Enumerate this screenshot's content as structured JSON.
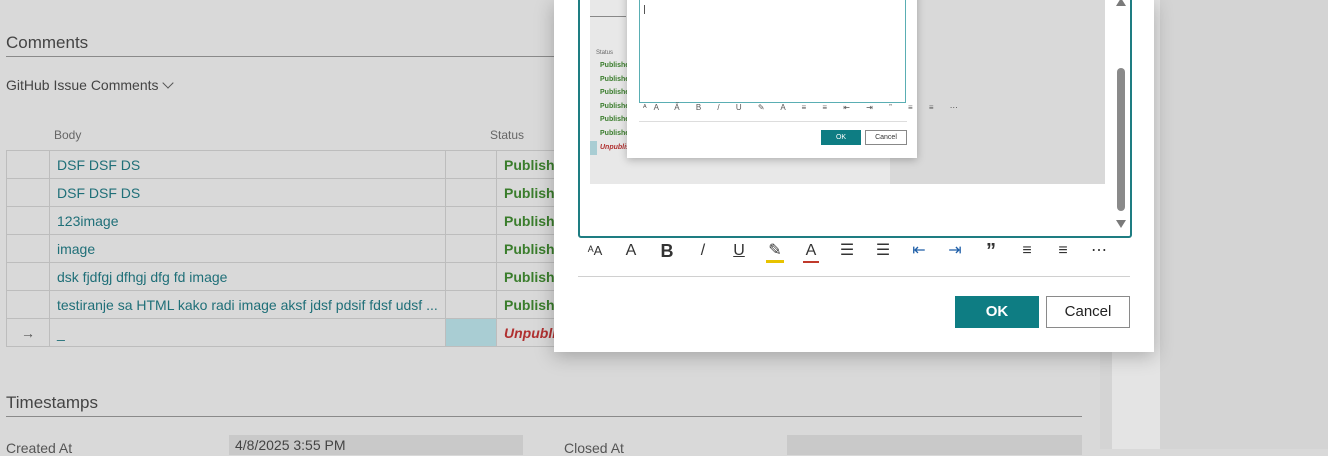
{
  "comments": {
    "section_title": "Comments",
    "sub_link": "GitHub Issue Comments",
    "columns": {
      "body": "Body",
      "status": "Status"
    },
    "rows": [
      {
        "marker": "",
        "body": "DSF DSF DS",
        "status": "Published"
      },
      {
        "marker": "",
        "body": "DSF DSF DS",
        "status": "Published"
      },
      {
        "marker": "",
        "body": "123image",
        "status": "Published"
      },
      {
        "marker": "",
        "body": "image",
        "status": "Published"
      },
      {
        "marker": "",
        "body": "dsk fjdfgj dfhgj dfg fd image",
        "status": "Published"
      },
      {
        "marker": "",
        "body": "testiranje sa HTML kako radi image aksf jdsf pdsif fdsf udsf ...",
        "status": "Published"
      },
      {
        "marker": "→",
        "body": "_",
        "status": "Unpublished"
      }
    ]
  },
  "timestamps": {
    "section_title": "Timestamps",
    "created_label": "Created At",
    "created_value": "4/8/2025 3:55 PM",
    "closed_label": "Closed At",
    "closed_value": ""
  },
  "dialog": {
    "preview": {
      "status_label": "Status",
      "rows": [
        "Published",
        "Published",
        "Published",
        "Published",
        "Published",
        "Published",
        "Unpublished"
      ],
      "toolbar_glyphs": "ᴬA A̋ B / U ✎ A ≡ ≡ ⇤ ⇥ ” ≡ ≡ ⋯",
      "ok": "OK",
      "cancel": "Cancel"
    },
    "toolbar": {
      "font_size": "ᴬA",
      "grow_font": "A",
      "bold": "B",
      "italic": "/",
      "underline": "U",
      "highlight": "✎",
      "font_color": "A",
      "bullets": "☰",
      "numbering": "☰",
      "outdent": "⇤",
      "indent": "⇥",
      "quote": "”",
      "align_left": "≡",
      "align_center": "≡",
      "more": "⋯"
    },
    "ok_label": "OK",
    "cancel_label": "Cancel"
  },
  "colors": {
    "accent": "#0e7d83",
    "published": "#3a7d2c",
    "unpublished": "#b03030",
    "link": "#1f6f78"
  }
}
